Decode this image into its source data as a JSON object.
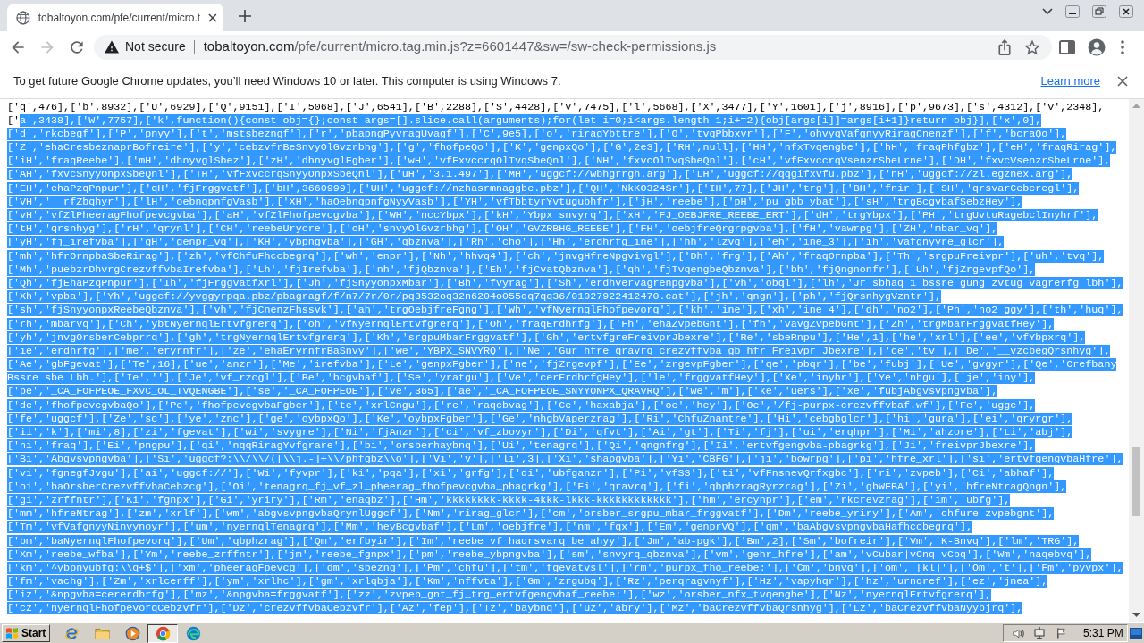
{
  "tabs": [
    {
      "title": "tobaltoyon.com/pfe/current/micro.t",
      "selected": true
    }
  ],
  "toolbar": {
    "forward_disabled": true,
    "security_label": "Not secure",
    "url_host": "tobaltoyon.com",
    "url_path": "/pfe/current/micro.tag.min.js?z=6601447&sw=/sw-check-permissions.js"
  },
  "infobar": {
    "message": "To get future Google Chrome updates, you’ll need Windows 10 or later. This computer is using Windows 7.",
    "link": "Learn more"
  },
  "source": {
    "lines": [
      {
        "segments": [
          {
            "text": "['q',476],['b',8932],['U',6929],['Q',9151],['I',5068],['J',6541],['B',2288],['S',4428],['V',7475],['l',5668],['X',3477],['Y',1601],['j',8916],['p',9673],['s',4312],['v',2348],",
            "selected": false
          }
        ]
      },
      {
        "segments": [
          {
            "text": "['",
            "selected": false
          },
          {
            "text": "a',3438],['W',7757],['k',function(){const obj={};const args=[].slice.call(arguments);for(let i=0;i<args.length-1;i+=2){obj[args[i]]=args[i+1]}return obj}],['x',0],",
            "selected": true
          }
        ]
      },
      {
        "segments": [
          {
            "text": "['d','rkcbegf'],['P','pnyy'],['t','mstsbezngf'],['r','pbapngPyvragUvagf'],['C',9e5],['o','riragYbttre'],['O','tvqPbbxvr'],['F','ohvyqVafgnyyRiragCnenzf'],['f','bcraQo'],",
            "selected": true
          }
        ]
      },
      {
        "segments": [
          {
            "text": "['Z','ehaCresbeznaprBofreire'],['y','cebzvfrBeSnvyOlGvzrbhg'],['g','fhofpeQo'],['K','genpxQo'],['G',2e3],['RH',null],['HH','nfxTvqengbe'],['hH','fraqPhfgbz'],['eH','fraqRirag'],",
            "selected": true
          }
        ]
      },
      {
        "segments": [
          {
            "text": "['iH','fraqReebe'],['mH','dhnyvglSbez'],['zH','dhnyvglFgber'],['wH','vfFxvccrqOlTvqSbeQnl'],['NH','fxvcOlTvqSbeQnl'],['cH','vfFxvccrqVsenzrSbeLrne'],['DH','fxvcVsenzrSbeLrne'],",
            "selected": true
          }
        ]
      },
      {
        "segments": [
          {
            "text": "['AH','fxvcSnyyOnpxSbeQnl'],['TH','vfFxvccrqSnyyOnpxSbeQnl'],['uH','3.1.497'],['MH','uggcf://wbhgrrgh.arg'],['LH','uggcf://qqgifxvfu.pbz'],['nH','uggcf://zl.egznex.arg'],",
            "selected": true
          }
        ]
      },
      {
        "segments": [
          {
            "text": "['EH','ehaPzqPnpur'],['qH','fjFrggvatf'],['bH',3660999],['UH','uggcf://nzhasrmnaggbe.pbz'],['QH','NkKO324Sr'],['IH',77],['JH','trg'],['BH','fnir'],['SH','qrsvarCebcregl'],",
            "selected": true
          }
        ]
      },
      {
        "segments": [
          {
            "text": "['VH','__rfZbqhyr'],['lH','oebnqpnfgVasb'],['XH','haOebnqpnfgNyyVasb'],['YH','vfTbbtyrYvtugubhfr'],['jH','reebe'],['pH','pu_gbb_ybat'],['sH','trgBcgvbafSebzHey'],",
            "selected": true
          }
        ]
      },
      {
        "segments": [
          {
            "text": "['vH','vfZlPheeragFhofpevcgvba'],['aH','vfZlFhofpevcgvba'],['WH','nccYbpx'],['kH','Ybpx snvyrq'],['xH','FJ_OEBJFRE_REEBE_ERT'],['dH','trgYbpx'],['PH','trgUvtuRagebclInyhrf'],",
            "selected": true
          }
        ]
      },
      {
        "segments": [
          {
            "text": "['tH','qrsnhyg'],['rH','qrynl'],['CH','reebeUrycre'],['oH','snvyOlGvzrbhg'],['OH','GVZRBHG_REEBE'],['FH','oebjfreQrgrpgvba'],['fH','vawrpg'],['ZH','mbar_vq'],",
            "selected": true
          }
        ]
      },
      {
        "segments": [
          {
            "text": "['yH','fj_irefvba'],['gH','genpr_vq'],['KH','ybpngvba'],['GH','qbznva'],['Rh','cho'],['Hh','erdhrfg_ine'],['hh','lzvq'],['eh','ine_3'],['ih','vafgnyyre_glcr'],",
            "selected": true
          }
        ]
      },
      {
        "segments": [
          {
            "text": "['mh','hfrOrnpbaSbeRirag'],['zh','vfChfuFhccbegrq'],['wh','enpr'],['Nh','hhvq4'],['ch','jnvgHfreNpgvivgl'],['Dh','frg'],['Ah','fraqOrnpba'],['Th','srgpuFreivpr'],['uh','tvq'],",
            "selected": true
          }
        ]
      },
      {
        "segments": [
          {
            "text": "['Mh','puebzrDhvrgCrezvffvbaIrefvba'],['Lh','fjIrefvba'],['nh','fjQbznva'],['Eh','fjCvatQbznva'],['qh','fjTvqengbeQbznva'],['bh','fjQngnonfr'],['Uh','fjZrgevpfQo'],",
            "selected": true
          }
        ]
      },
      {
        "segments": [
          {
            "text": "['Qh','fjEhaPzqPnpur'],['Ih','fjFrggvatfXrl'],['Jh','fjSnyyonpxMbar'],['Bh','fvyrag'],['Sh','erdhverVagrenpgvba'],['Vh','obql'],['lh','Jr sbhaq 1 bssre gung zvtug vagrerfg lbh'],",
            "selected": true
          }
        ]
      },
      {
        "segments": [
          {
            "text": "['Xh','vpba'],['Yh','uggcf://yvggyrpqa.pbz/pbagragf/f/n7/7r/0r/pq3532oq32n6204o055qq7qq36/01027922412470.cat'],['jh','qngn'],['ph','fjQrsnhygVzntr'],",
            "selected": true
          }
        ]
      },
      {
        "segments": [
          {
            "text": "['sh','fjSnyyonpxReebeQbznva'],['vh','fjCnenzFhssvk'],['ah','trgOebjfreFgng'],['Wh','vfNyernqlFhofpevorq'],['kh','ine'],['xh','ine_4'],['dh','no2'],['Ph','no2_ggy'],['th','huq'],",
            "selected": true
          }
        ]
      },
      {
        "segments": [
          {
            "text": "['rh','mbarVq'],['Ch','ybtNyernqlErtvfgrerq'],['oh','vfNyernqlErtvfgrerq'],['Oh','fraqErdhrfg'],['Fh','ehaZvpebGnt'],['fh','vavgZvpebGnt'],['Zh','trgMbarFrggvatfHey'],",
            "selected": true
          }
        ]
      },
      {
        "segments": [
          {
            "text": "['yh','jnvgOrsberCebprrq'],['gh','trgNyernqlErtvfgrerq'],['Kh','srgpuMbarFrggvatf'],['Gh','ertvfgreFreivprJbexre'],['Re','sbeRnpu'],['He',1],['he','xrl'],['ee','vfYbpxrq'],",
            "selected": true
          }
        ]
      },
      {
        "segments": [
          {
            "text": "['ie','erdhrfg'],['me','eryrnfr'],['ze','ehaEryrnfrBaSnvy'],['we','YBPX_SNVYRQ'],['Ne','Gur hfre qravrq crezvffvba gb hfr Freivpr Jbexre'],['ce','tv'],['De','__vzcbegQrsnhyg'],",
            "selected": true
          }
        ]
      },
      {
        "segments": [
          {
            "text": "['Ae','gbFgevat'],['Te',16],['ue','anzr'],['Me','irefvba'],['Le','genpxFgber'],['ne','fjZrgevpf'],['Ee','zrgevpFgber'],['qe','pbqr'],['be','fubj'],['Ue','gvgyr'],['Qe','Crefbany",
            "selected": true
          }
        ]
      },
      {
        "segments": [
          {
            "text": "Bssre sbe Lbh.'],['Ie',''],['Je','vf_rzcgl'],['Be','bcgvbaf'],['Se','yratgu'],['Ve','cerErdhrfgHey'],['le','frggvatfHey'],['Xe','inyhr'],['Ye','nhgu'],['je','iny'],",
            "selected": true
          }
        ]
      },
      {
        "segments": [
          {
            "text": "['pe','_CA_FOFPEOE_FXVC_OL_TVQENGBE'],['se','_CA_FOFPEOE'],['ve',365],['ae','_CA_FOFPEOE_SNYYONPX_QRAVRQ'],['We','m'],['ke','uers'],['xe','fubjAbgvsvpngvba'],",
            "selected": true
          }
        ]
      },
      {
        "segments": [
          {
            "text": "['de','fhofpevcgvbaQo'],['Pe','fhofpevcgvbaFgber'],['te','xrlCngu'],['re','raqcbvag'],['Ce','haxabja'],['oe','hey'],['Oe','/fj-purpx-crezvffvbaf.wf'],['Fe','uggc'],",
            "selected": true
          }
        ]
      },
      {
        "segments": [
          {
            "text": "['fe','uggcf'],['Ze','sc'],['ye','znc'],['ge','oybpxQo'],['Ke','oybpxFgber'],['Ge','nhgbVaperzrag'],['Ri','ChfuZnantre'],['Hi','cebgbglcr'],['hi','gura'],['ei','qryrgr'],",
            "selected": true
          }
        ]
      },
      {
        "segments": [
          {
            "text": "['ii','k'],['mi',8],['zi','fgevat'],['wi','svygre'],['Ni','fjAnzr'],['ci','vf_zbovyr'],['Di','qfvt'],['Ai','gt'],['Ti','fj'],['ui','erqhpr'],['Mi','ahzore'],['Li','abj'],",
            "selected": true
          }
        ]
      },
      {
        "segments": [
          {
            "text": "['ni','fraq'],['Ei','pngpu'],['qi','nqqRiragYvfgrare'],['bi','orsberhaybnq'],['Ui','tenagrq'],['Qi','qngnfrg'],['Ii','ertvfgengvba-pbagrkg'],['Ji','freivprJbexre'],",
            "selected": true
          }
        ]
      },
      {
        "segments": [
          {
            "text": "['Bi','Abgvsvpngvba'],['Si','uggcf?:\\\\/\\\\/([\\\\j.-]+\\\\/phfgbz\\\\o'],['Vi','v'],['li',3],['Xi','shapgvba'],['Yi','CBFG'],['ji','bowrpg'],['pi','hfre_xrl'],['si','ertvfgengvbaHfre'],",
            "selected": true
          }
        ]
      },
      {
        "segments": [
          {
            "text": "['vi','fgnegfJvgu'],['ai','uggcf://'],['Wi','fyvpr'],['ki','pqa'],['xi','grfg'],['di','ubfganzr'],['Pi','vfSS'],['ti','vfFnsnevQrfxgbc'],['ri','zvpeb'],['Ci','abhaf'],",
            "selected": true
          }
        ]
      },
      {
        "segments": [
          {
            "text": "['oi','baOrsberCrezvffvbaCebzcg'],['Oi','tenagrq_fj_vf_zl_pheerag_fhofpevcgvba_pbagrkg'],['Fi','qravrq'],['fi','qbphzragRyrzrag'],['Zi','gbWFBA'],['yi','hfreNtragQngn'],",
            "selected": true
          }
        ]
      },
      {
        "segments": [
          {
            "text": "['gi','zrffntr'],['Ki','fgnpx'],['Gi','yriry'],['Rm','enaqbz'],['Hm','kkkkkkkk-kkkk-4kkk-lkkk-kkkkkkkkkkkk'],['hm','ercynpr'],['em','rkcrevzrag'],['im','ubfg'],",
            "selected": true
          }
        ]
      },
      {
        "segments": [
          {
            "text": "['mm','hfreNtrag'],['zm','xrlf'],['wm','abgvsvpngvbaQrynlUggcf'],['Nm','rirag_glcr'],['cm','orsber_srgpu_mbar_frggvatf'],['Dm','reebe_yriry'],['Am','chfure-zvpebgnt'],",
            "selected": true
          }
        ]
      },
      {
        "segments": [
          {
            "text": "['Tm','vfVafgnyyNinvynoyr'],['um','nyernqlTenagrq'],['Mm','heyBcgvbaf'],['Lm','oebjfre'],['nm','fqx'],['Em','genprVQ'],['qm','baAbgvsvpngvbaHafhccbegrq'],",
            "selected": true
          }
        ]
      },
      {
        "segments": [
          {
            "text": "['bm','baNyernqlFhofpevorq'],['Um','qbphzrag'],['Qm','erfbyir'],['Im','reebe vf haqrsvarq be ahyy'],['Jm','ab-pgk'],['Bm',2],['Sm','bofreir'],['Vm','K-Bnvq'],['lm','TRG'],",
            "selected": true
          }
        ]
      },
      {
        "segments": [
          {
            "text": "['Xm','reebe_wfba'],['Ym','reebe_zrffntr'],['jm','reebe_fgnpx'],['pm','reebe_ybpngvba'],['sm','snvyrq_qbznva'],['vm','gehr_hfre'],['am','vCubar|vCnq|vCbq'],['Wm','naqebvq'],",
            "selected": true
          }
        ]
      },
      {
        "segments": [
          {
            "text": "['km','^ybpnyubfg:\\\\q+$'],['xm','pheeragFpevcg'],['dm','sbezng'],['Pm','chfu'],['tm','fgevatvsl'],['rm','purpx_fho_reebe:'],['Cm','bnvq'],['om','[kl]'],['Om','t'],['Fm','pyvpx'],",
            "selected": true
          }
        ]
      },
      {
        "segments": [
          {
            "text": "['fm','vachg'],['Zm','xrlcerff'],['ym','xrlhc'],['gm','xrlqbja'],['Km','nffvta'],['Gm','zrgubq'],['Rz','perqragvnyf'],['Hz','vapyhqr'],['hz','urnqref'],['ez','jnea'],",
            "selected": true
          }
        ]
      },
      {
        "segments": [
          {
            "text": "['iz','&npgvba=cererdhrfg'],['mz','&npgvba=frggvatf'],['zz','zvpeb_gnt_fj_trg_ertvfgengvbaf_reebe:'],['wz','orsber_nfx_tvqengbe'],['Nz','nyernqlErtvfgrerq'],",
            "selected": true
          }
        ]
      },
      {
        "segments": [
          {
            "text": "['cz','nyernqlFhofpevorqCebzvfr'],['Dz','crezvffvbaCebzvfr'],['Az','fep'],['Tz','baybnq'],['uz','abry'],['Mz','baCrezvffvbaQrsnhyg'],['Lz','baCrezvffvbaNyybjrq'],",
            "selected": true
          }
        ]
      }
    ]
  },
  "taskbar": {
    "start": "Start",
    "pinned": [
      {
        "selected": false
      },
      {
        "selected": false
      },
      {
        "selected": false
      },
      {
        "selected": true
      },
      {
        "selected": false
      }
    ],
    "clock": "5:31 PM"
  }
}
